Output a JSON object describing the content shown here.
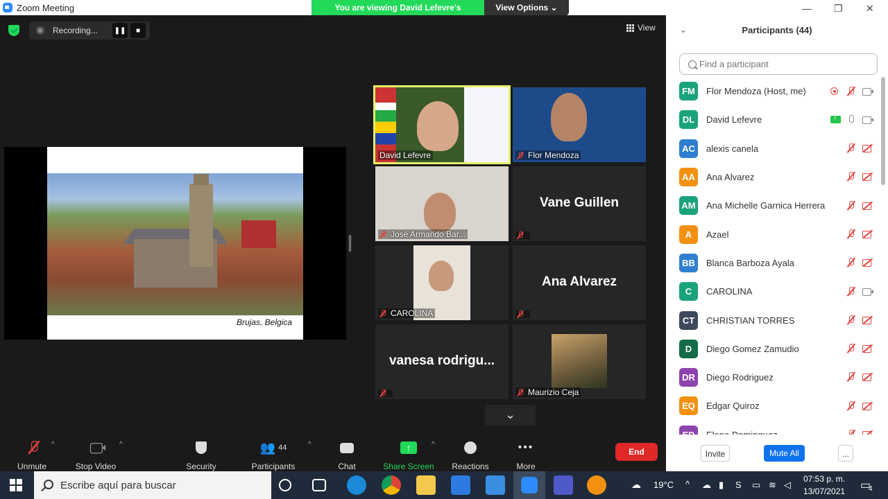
{
  "window": {
    "title": "Zoom Meeting"
  },
  "banner": {
    "viewing": "You are viewing David Lefevre's screen",
    "view_options": "View Options ⌄"
  },
  "recording": {
    "label": "Recording..."
  },
  "view_button": {
    "label": "View"
  },
  "shared_slide": {
    "caption": "Brujas, Belgica"
  },
  "tiles": [
    {
      "name": "David Lefevre",
      "big": ""
    },
    {
      "name": "Flor Mendoza",
      "big": ""
    },
    {
      "name": "José Armando Bar...",
      "big": ""
    },
    {
      "name": "",
      "big": "Vane Guillen"
    },
    {
      "name": "CAROLINA",
      "big": ""
    },
    {
      "name": "",
      "big": "Ana Alvarez"
    },
    {
      "name": "",
      "big": "vanesa  rodrigu..."
    },
    {
      "name": "Maurizio Ceja",
      "big": ""
    }
  ],
  "toolbar": {
    "unmute": "Unmute",
    "stop_video": "Stop Video",
    "security": "Security",
    "participants": "Participants",
    "participants_count": "44",
    "chat": "Chat",
    "share_screen": "Share Screen",
    "reactions": "Reactions",
    "more": "More",
    "end": "End"
  },
  "panel": {
    "title": "Participants (44)",
    "search_placeholder": "Find a participant",
    "invite": "Invite",
    "mute_all": "Mute All",
    "more": "...",
    "participants": [
      {
        "initials": "FM",
        "name": "Flor Mendoza (Host, me)",
        "color": "#1aa37a",
        "icons": [
          "rec",
          "mic-off",
          "cam-on"
        ]
      },
      {
        "initials": "DL",
        "name": "David Lefevre",
        "color": "#1aa37a",
        "icons": [
          "share",
          "mic-on",
          "cam-on"
        ]
      },
      {
        "initials": "AC",
        "name": "alexis canela",
        "color": "#2e7fcf",
        "icons": [
          "mic-off",
          "cam-off"
        ]
      },
      {
        "initials": "AA",
        "name": "Ana Alvarez",
        "color": "#f29111",
        "icons": [
          "mic-off",
          "cam-off"
        ]
      },
      {
        "initials": "AM",
        "name": "Ana Michelle Garnica Herrera",
        "color": "#1aa37a",
        "icons": [
          "mic-off",
          "cam-off"
        ]
      },
      {
        "initials": "A",
        "name": "Azael",
        "color": "#f29111",
        "icons": [
          "mic-off",
          "cam-off"
        ]
      },
      {
        "initials": "BB",
        "name": "Blanca Barboza Ayala",
        "color": "#2e7fcf",
        "icons": [
          "mic-off",
          "cam-off"
        ]
      },
      {
        "initials": "C",
        "name": "CAROLINA",
        "color": "#1aa37a",
        "icons": [
          "mic-off",
          "cam-on"
        ]
      },
      {
        "initials": "CT",
        "name": "CHRISTIAN TORRES",
        "color": "#3d4a5c",
        "icons": [
          "mic-off",
          "cam-off"
        ]
      },
      {
        "initials": "D",
        "name": "Diego Gomez Zamudio",
        "color": "#146b4a",
        "icons": [
          "mic-off",
          "cam-off"
        ]
      },
      {
        "initials": "DR",
        "name": "Diego Rodriguez",
        "color": "#8e44ad",
        "icons": [
          "mic-off",
          "cam-off"
        ]
      },
      {
        "initials": "EQ",
        "name": "Edgar Quiroz",
        "color": "#f29111",
        "icons": [
          "mic-off",
          "cam-off"
        ]
      },
      {
        "initials": "ED",
        "name": "Elena Dominguez",
        "color": "#8e44ad",
        "icons": [
          "mic-off",
          "cam-off"
        ]
      }
    ]
  },
  "taskbar": {
    "search_placeholder": "Escribe aquí para buscar",
    "weather": "19°C",
    "time": "07:53 p. m.",
    "date": "13/07/2021",
    "notifications": "4"
  }
}
